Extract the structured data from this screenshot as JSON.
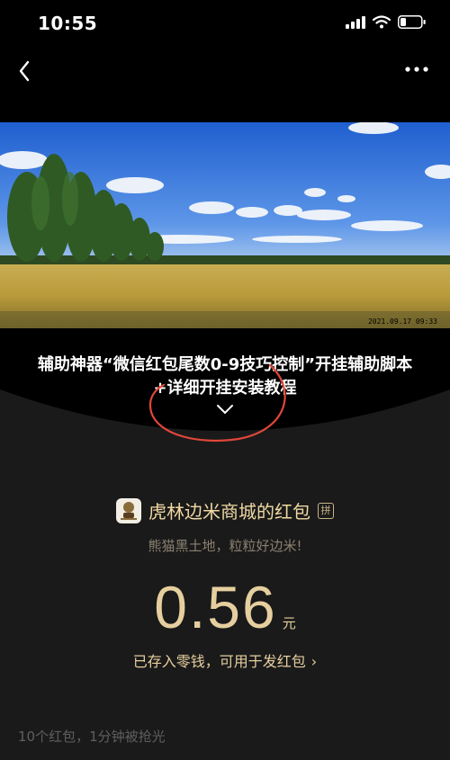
{
  "status_bar": {
    "time": "10:55",
    "battery_level": 0.2
  },
  "nav": {
    "back_icon": "chevron-left-icon",
    "more_icon": "more-dots-icon"
  },
  "banner": {
    "timestamp": "2021.09.17 09:33"
  },
  "article": {
    "title": "辅助神器“微信红包尾数0-9技巧控制”开挂辅助脚本+详细开挂安装教程"
  },
  "red_packet": {
    "sender": "虎林边米商城的红包",
    "pin_badge": "拼",
    "greeting": "熊猫黑土地，粒粒好边米!",
    "amount": "0.56",
    "unit": "元",
    "saved_text": "已存入零钱，可用于发红包",
    "saved_arrow": "›",
    "summary": "10个红包，1分钟被抢光"
  },
  "colors": {
    "gold": "#e6cf9f",
    "background": "#1a1a1a",
    "annotation": "#e0473a"
  }
}
